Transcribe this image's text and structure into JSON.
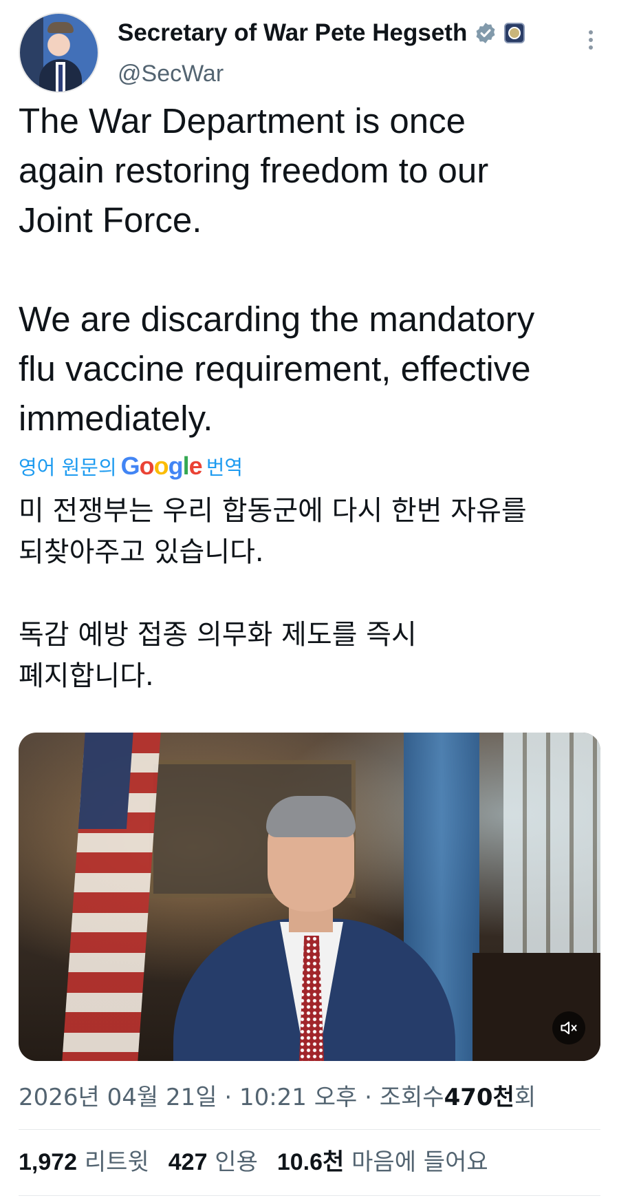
{
  "header": {
    "display_name": "Secretary of War Pete Hegseth",
    "handle": "@SecWar",
    "verified_badge_icon": "verified-badge-icon",
    "affiliation_icon": "department-seal-icon",
    "more_icon": "more-vertical-icon"
  },
  "tweet": {
    "paragraphs": [
      "The War Department is once\nagain restoring freedom to our\nJoint Force.",
      "We are discarding the mandatory\nflu vaccine requirement, effective\nimmediately."
    ]
  },
  "translation": {
    "prefix": "영어 원문의",
    "provider_letters": [
      "G",
      "o",
      "o",
      "g",
      "l",
      "e"
    ],
    "suffix": "번역",
    "paragraphs": [
      "미 전쟁부는 우리 합동군에 다시 한번 자유를\n되찾아주고 있습니다.",
      "독감 예방 접종 의무화 제도를 즉시\n폐지합니다."
    ]
  },
  "media": {
    "mute_icon": "speaker-muted-icon"
  },
  "meta": {
    "date": "2026년 04월 21일",
    "separator": "·",
    "time": "10:21 오후",
    "views_label": "조회수",
    "views_value": "470천",
    "views_suffix": "회"
  },
  "stats": {
    "retweets_value": "1,972",
    "retweets_label": "리트윗",
    "quotes_value": "427",
    "quotes_label": "인용",
    "likes_value": "10.6천",
    "likes_label": "마음에 들어요"
  },
  "colors": {
    "link_blue": "#1d9bf0",
    "secondary_text": "#536471",
    "primary_text": "#0f1419"
  }
}
